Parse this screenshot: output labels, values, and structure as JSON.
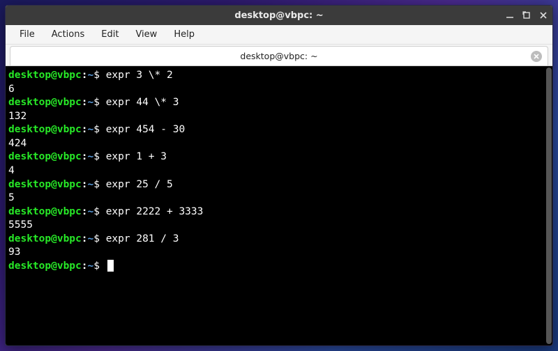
{
  "window": {
    "title": "desktop@vbpc: ~"
  },
  "menu": {
    "file": "File",
    "actions": "Actions",
    "edit": "Edit",
    "view": "View",
    "help": "Help"
  },
  "tab": {
    "title": "desktop@vbpc: ~"
  },
  "prompt": {
    "user_host": "desktop@vbpc",
    "colon": ":",
    "path": "~",
    "dollar": "$"
  },
  "session": [
    {
      "cmd": "expr 3 \\* 2",
      "out": "6"
    },
    {
      "cmd": "expr 44 \\* 3",
      "out": "132"
    },
    {
      "cmd": "expr 454 - 30",
      "out": "424"
    },
    {
      "cmd": "expr 1 + 3",
      "out": "4"
    },
    {
      "cmd": "expr 25 / 5",
      "out": "5"
    },
    {
      "cmd": "expr 2222 + 3333",
      "out": "5555"
    },
    {
      "cmd": "expr 281 / 3",
      "out": "93"
    }
  ],
  "controls": {
    "minimize": "–",
    "maximize": "❐",
    "close": "✕"
  },
  "tab_close": "✕"
}
